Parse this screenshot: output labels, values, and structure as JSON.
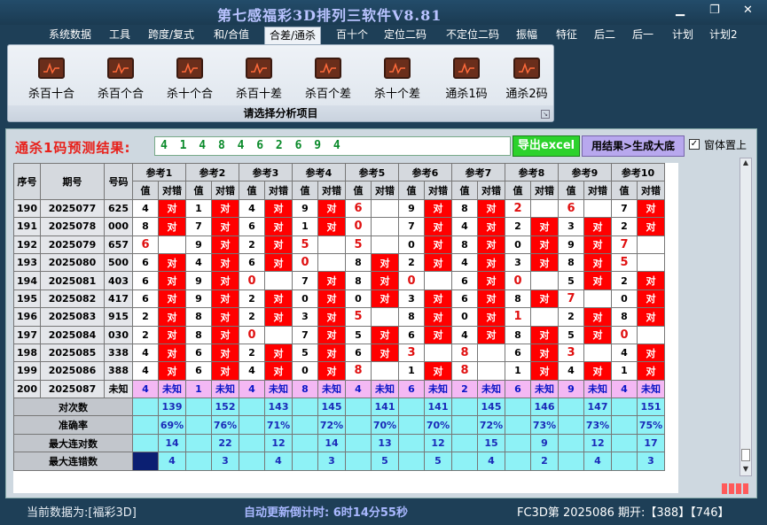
{
  "app": {
    "title": "第七感福彩3D排列三软件V8.81",
    "min_icon": "minimize-icon",
    "max_icon": "restore-icon",
    "close_icon": "close-icon"
  },
  "menu": [
    "系统数据",
    "工具",
    "跨度/复式",
    "和/合值",
    "合差/通杀",
    "百十个",
    "定位二码",
    "不定位二码",
    "振幅",
    "特征",
    "后二",
    "后一",
    "计划",
    "计划2"
  ],
  "menu_active": 4,
  "ribbon": {
    "buttons": [
      "杀百十合",
      "杀百个合",
      "杀十个合",
      "杀百十差",
      "杀百个差",
      "杀十个差",
      "通杀1码",
      "通杀2码"
    ],
    "caption": "请选择分析项目",
    "icon": "chart-icon"
  },
  "predict": {
    "label": "通杀1码预测结果:",
    "value": "4 1 4 8 4 6 2 6 9 4",
    "export_label": "导出excel",
    "generate_label": "用结果>生成大底",
    "ontop_label": "窗体置上",
    "ontop_checked": "✓"
  },
  "table": {
    "headers": {
      "seq": "序号",
      "issue": "期号",
      "number": "号码",
      "value": "值",
      "result": "对错"
    },
    "refs": [
      "参考1",
      "参考2",
      "参考3",
      "参考4",
      "参考5",
      "参考6",
      "参考7",
      "参考8",
      "参考9",
      "参考10"
    ],
    "rows": [
      {
        "seq": "190",
        "issue": "2025077",
        "num": "625",
        "refs": [
          [
            "4",
            "对"
          ],
          [
            "1",
            "对"
          ],
          [
            "4",
            "对"
          ],
          [
            "9",
            "对"
          ],
          [
            "6",
            ""
          ],
          [
            "9",
            "对"
          ],
          [
            "8",
            "对"
          ],
          [
            "2",
            ""
          ],
          [
            "6",
            ""
          ],
          [
            "7",
            "对"
          ]
        ]
      },
      {
        "seq": "191",
        "issue": "2025078",
        "num": "000",
        "refs": [
          [
            "8",
            "对"
          ],
          [
            "7",
            "对"
          ],
          [
            "6",
            "对"
          ],
          [
            "1",
            "对"
          ],
          [
            "0",
            ""
          ],
          [
            "7",
            "对"
          ],
          [
            "4",
            "对"
          ],
          [
            "2",
            "对"
          ],
          [
            "3",
            "对"
          ],
          [
            "2",
            "对"
          ]
        ]
      },
      {
        "seq": "192",
        "issue": "2025079",
        "num": "657",
        "refs": [
          [
            "6",
            ""
          ],
          [
            "9",
            "对"
          ],
          [
            "2",
            "对"
          ],
          [
            "5",
            ""
          ],
          [
            "5",
            ""
          ],
          [
            "0",
            "对"
          ],
          [
            "8",
            "对"
          ],
          [
            "0",
            "对"
          ],
          [
            "9",
            "对"
          ],
          [
            "7",
            ""
          ]
        ]
      },
      {
        "seq": "193",
        "issue": "2025080",
        "num": "500",
        "refs": [
          [
            "6",
            "对"
          ],
          [
            "4",
            "对"
          ],
          [
            "6",
            "对"
          ],
          [
            "0",
            ""
          ],
          [
            "8",
            "对"
          ],
          [
            "2",
            "对"
          ],
          [
            "4",
            "对"
          ],
          [
            "3",
            "对"
          ],
          [
            "8",
            "对"
          ],
          [
            "5",
            ""
          ]
        ]
      },
      {
        "seq": "194",
        "issue": "2025081",
        "num": "403",
        "refs": [
          [
            "6",
            "对"
          ],
          [
            "9",
            "对"
          ],
          [
            "0",
            ""
          ],
          [
            "7",
            "对"
          ],
          [
            "8",
            "对"
          ],
          [
            "0",
            ""
          ],
          [
            "6",
            "对"
          ],
          [
            "0",
            ""
          ],
          [
            "5",
            "对"
          ],
          [
            "2",
            "对"
          ]
        ]
      },
      {
        "seq": "195",
        "issue": "2025082",
        "num": "417",
        "refs": [
          [
            "6",
            "对"
          ],
          [
            "9",
            "对"
          ],
          [
            "2",
            "对"
          ],
          [
            "0",
            "对"
          ],
          [
            "0",
            "对"
          ],
          [
            "3",
            "对"
          ],
          [
            "6",
            "对"
          ],
          [
            "8",
            "对"
          ],
          [
            "7",
            ""
          ],
          [
            "0",
            "对"
          ]
        ]
      },
      {
        "seq": "196",
        "issue": "2025083",
        "num": "915",
        "refs": [
          [
            "2",
            "对"
          ],
          [
            "8",
            "对"
          ],
          [
            "2",
            "对"
          ],
          [
            "3",
            "对"
          ],
          [
            "5",
            ""
          ],
          [
            "8",
            "对"
          ],
          [
            "0",
            "对"
          ],
          [
            "1",
            ""
          ],
          [
            "2",
            "对"
          ],
          [
            "8",
            "对"
          ]
        ]
      },
      {
        "seq": "197",
        "issue": "2025084",
        "num": "030",
        "refs": [
          [
            "2",
            "对"
          ],
          [
            "8",
            "对"
          ],
          [
            "0",
            ""
          ],
          [
            "7",
            "对"
          ],
          [
            "5",
            "对"
          ],
          [
            "6",
            "对"
          ],
          [
            "4",
            "对"
          ],
          [
            "8",
            "对"
          ],
          [
            "5",
            "对"
          ],
          [
            "0",
            ""
          ]
        ]
      },
      {
        "seq": "198",
        "issue": "2025085",
        "num": "338",
        "refs": [
          [
            "4",
            "对"
          ],
          [
            "6",
            "对"
          ],
          [
            "2",
            "对"
          ],
          [
            "5",
            "对"
          ],
          [
            "6",
            "对"
          ],
          [
            "3",
            ""
          ],
          [
            "8",
            ""
          ],
          [
            "6",
            "对"
          ],
          [
            "3",
            ""
          ],
          [
            "4",
            "对"
          ]
        ]
      },
      {
        "seq": "199",
        "issue": "2025086",
        "num": "388",
        "refs": [
          [
            "4",
            "对"
          ],
          [
            "6",
            "对"
          ],
          [
            "4",
            "对"
          ],
          [
            "0",
            "对"
          ],
          [
            "8",
            ""
          ],
          [
            "1",
            "对"
          ],
          [
            "8",
            ""
          ],
          [
            "1",
            "对"
          ],
          [
            "4",
            "对"
          ],
          [
            "1",
            "对"
          ]
        ]
      }
    ],
    "pred_row": {
      "seq": "200",
      "issue": "2025087",
      "num": "未知",
      "refs": [
        [
          "4",
          "未知"
        ],
        [
          "1",
          "未知"
        ],
        [
          "4",
          "未知"
        ],
        [
          "8",
          "未知"
        ],
        [
          "4",
          "未知"
        ],
        [
          "6",
          "未知"
        ],
        [
          "2",
          "未知"
        ],
        [
          "6",
          "未知"
        ],
        [
          "9",
          "未知"
        ],
        [
          "4",
          "未知"
        ]
      ]
    },
    "stats": [
      {
        "label": "对次数",
        "values": [
          "139",
          "152",
          "143",
          "145",
          "141",
          "141",
          "145",
          "146",
          "147",
          "151"
        ]
      },
      {
        "label": "准确率",
        "values": [
          "69%",
          "76%",
          "71%",
          "72%",
          "70%",
          "70%",
          "72%",
          "73%",
          "73%",
          "75%"
        ]
      },
      {
        "label": "最大连对数",
        "values": [
          "14",
          "22",
          "12",
          "14",
          "13",
          "12",
          "15",
          "9",
          "12",
          "17"
        ]
      },
      {
        "label": "最大连错数",
        "values": [
          "4",
          "3",
          "4",
          "3",
          "5",
          "5",
          "4",
          "2",
          "4",
          "3"
        ]
      }
    ]
  },
  "status": {
    "source": "当前数据为:[福彩3D]",
    "countdown": "自动更新倒计时: 6时14分55秒",
    "issue": "FC3D第 2025086 期开:【388】【746】"
  },
  "colors": {
    "hit": "#ff0000",
    "predict_row": "#f4b8f4",
    "stats": "#8ef2f6",
    "title": "#b9c3ff",
    "predict_label": "#e8201a"
  }
}
